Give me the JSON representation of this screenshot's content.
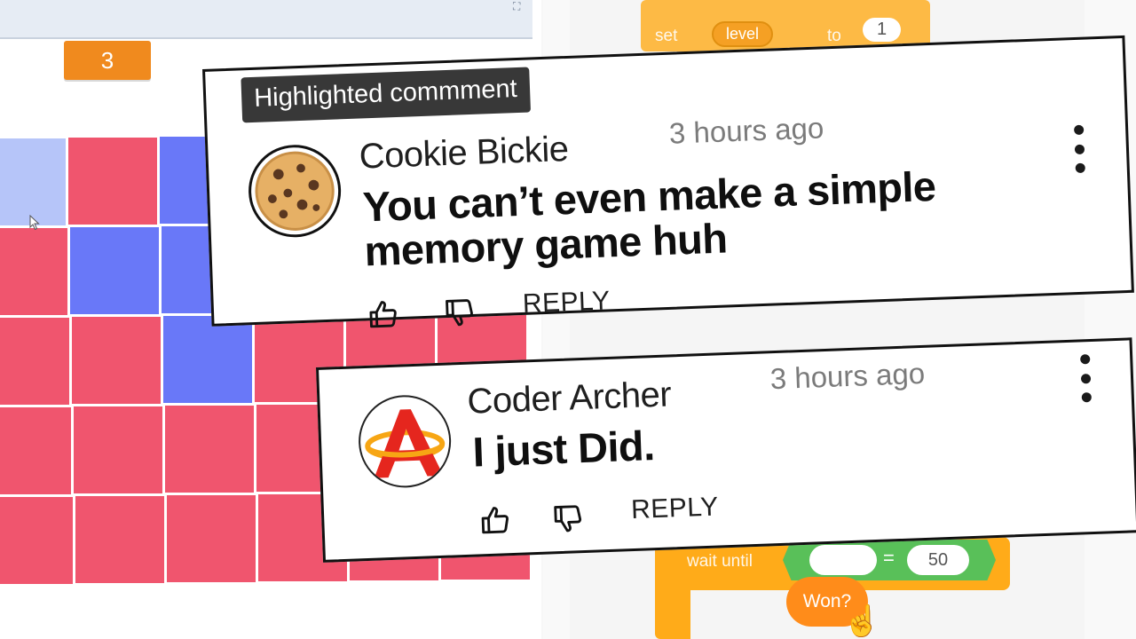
{
  "stage": {
    "level_monitor_value": "3",
    "grid_colors": {
      "red": "#f0556e",
      "blue": "#6978f8",
      "light_blue": "#b6c5f9",
      "grid_line": "#ffffff"
    }
  },
  "code": {
    "set_block": {
      "label": "set",
      "variable": "level",
      "to_label": "to",
      "value": "1"
    },
    "wait_block": {
      "label": "wait until",
      "operator": "=",
      "compare_value": "50"
    },
    "won_reporter": "Won?",
    "colors": {
      "control": "#ffab19",
      "operator": "#59c059",
      "variable": "#ff8c1a"
    }
  },
  "comments": [
    {
      "badge": "Highlighted commment",
      "author": "Cookie Bickie",
      "time": "3 hours ago",
      "text_lines": [
        "You can’t even make a simple",
        "memory game huh"
      ],
      "reply_label": "REPLY",
      "avatar_icon": "cookie-icon"
    },
    {
      "author": "Coder Archer",
      "time": "3 hours ago",
      "text_lines": [
        "I just Did."
      ],
      "reply_label": "REPLY",
      "avatar_icon": "archer-logo-icon"
    }
  ]
}
